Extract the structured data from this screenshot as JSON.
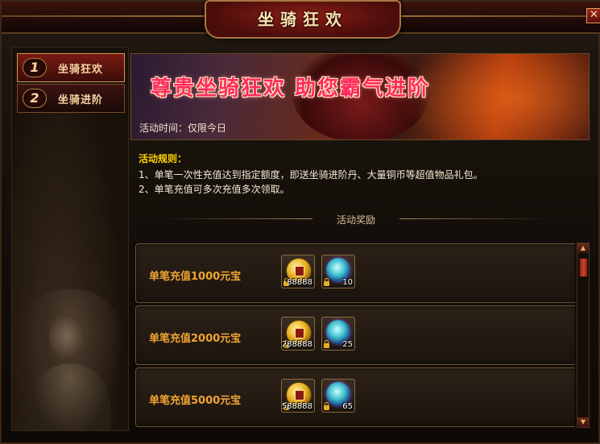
{
  "window": {
    "title": "坐骑狂欢",
    "close": "✕"
  },
  "sidebar": {
    "items": [
      {
        "num": "1",
        "label": "坐骑狂欢"
      },
      {
        "num": "2",
        "label": "坐骑进阶"
      }
    ]
  },
  "banner": {
    "title": "尊贵坐骑狂欢  助您霸气进阶",
    "time": "活动时间：仅限今日"
  },
  "rules": {
    "title": "活动规则：",
    "lines": [
      "1、单笔一次性充值达到指定额度，即送坐骑进阶丹、大量铜币等超值物品礼包。",
      "2、单笔充值可多次充值多次领取。"
    ]
  },
  "rewards_header": "活动奖励",
  "rewards": [
    {
      "label": "单笔充值1000元宝",
      "items": [
        {
          "icon": "gold-coin-icon",
          "qty": "88888"
        },
        {
          "icon": "orb-icon",
          "qty": "10"
        }
      ]
    },
    {
      "label": "单笔充值2000元宝",
      "items": [
        {
          "icon": "gold-coin-icon",
          "qty": "288888"
        },
        {
          "icon": "orb-icon",
          "qty": "25"
        }
      ]
    },
    {
      "label": "单笔充值5000元宝",
      "items": [
        {
          "icon": "gold-coin-icon",
          "qty": "588888"
        },
        {
          "icon": "orb-icon",
          "qty": "65"
        }
      ]
    }
  ],
  "scrollbar": {
    "up": "▲",
    "down": "▼"
  },
  "colors": {
    "accent_red": "#7a1a14",
    "gold": "#f0a433",
    "rule_title": "#ffd400",
    "banner_title": "#ff2a60"
  }
}
